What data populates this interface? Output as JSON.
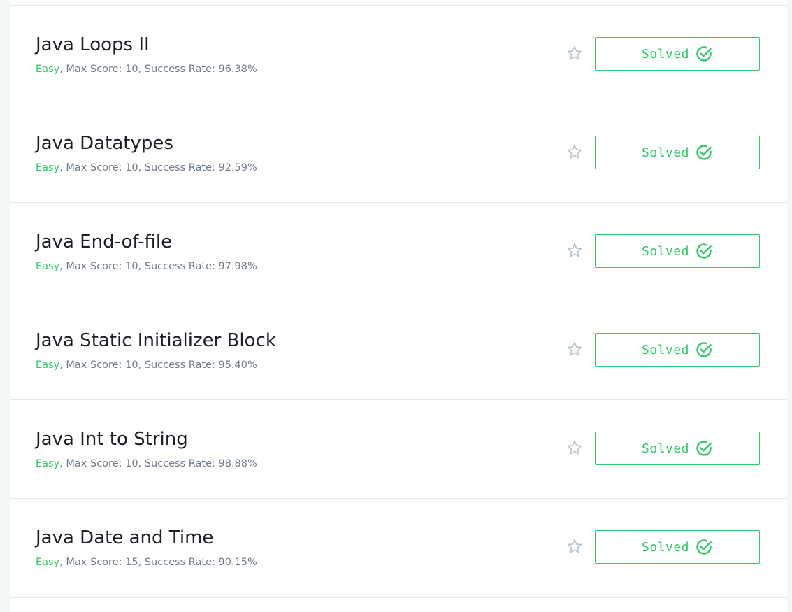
{
  "colors": {
    "accent": "#2ec866",
    "text": "#1d1f26",
    "muted": "#6f7b86",
    "star": "#b7c3cc",
    "background": "#f3f7f7"
  },
  "challenges": [
    {
      "title": "Java Loops II",
      "difficulty": "Easy",
      "rest": ", Max Score: 10, Success Rate: 96.38%",
      "status": "Solved"
    },
    {
      "title": "Java Datatypes",
      "difficulty": "Easy",
      "rest": ", Max Score: 10, Success Rate: 92.59%",
      "status": "Solved"
    },
    {
      "title": "Java End-of-file",
      "difficulty": "Easy",
      "rest": ", Max Score: 10, Success Rate: 97.98%",
      "status": "Solved"
    },
    {
      "title": "Java Static Initializer Block",
      "difficulty": "Easy",
      "rest": ", Max Score: 10, Success Rate: 95.40%",
      "status": "Solved"
    },
    {
      "title": "Java Int to String",
      "difficulty": "Easy",
      "rest": ", Max Score: 10, Success Rate: 98.88%",
      "status": "Solved"
    },
    {
      "title": "Java Date and Time",
      "difficulty": "Easy",
      "rest": ", Max Score: 15, Success Rate: 90.15%",
      "status": "Solved"
    }
  ]
}
